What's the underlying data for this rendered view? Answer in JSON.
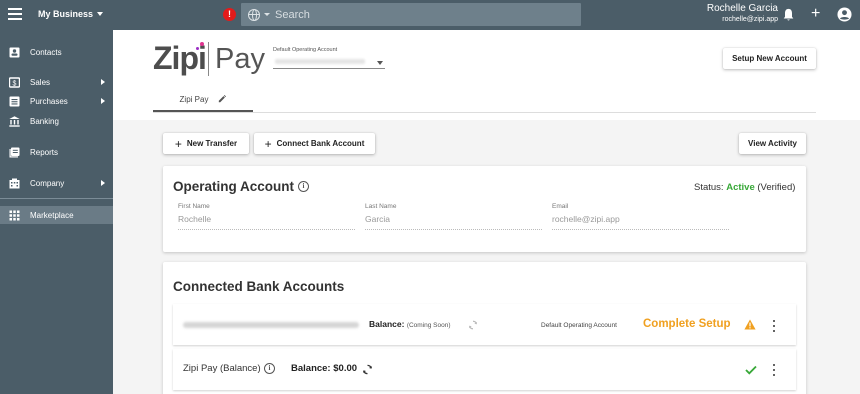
{
  "topbar": {
    "business_label": "My Business",
    "alert_badge": "!",
    "search_placeholder": "Search",
    "user_name": "Rochelle Garcia",
    "user_email": "rochelle@zipi.app",
    "plus_label": "+"
  },
  "sidebar": {
    "items": [
      {
        "label": "Contacts",
        "icon": "contacts-icon"
      },
      {
        "label": "Sales",
        "icon": "sales-icon",
        "has_submenu": true
      },
      {
        "label": "Purchases",
        "icon": "purchases-icon",
        "has_submenu": true
      },
      {
        "label": "Banking",
        "icon": "bank-icon"
      },
      {
        "label": "Reports",
        "icon": "reports-icon"
      },
      {
        "label": "Company",
        "icon": "company-icon",
        "has_submenu": true
      },
      {
        "label": "Marketplace",
        "icon": "grid-icon",
        "active": true
      }
    ]
  },
  "header": {
    "logo_text_left": "Zipi",
    "logo_text_right": "Pay",
    "default_operating_account_label": "Default Operating Account",
    "setup_new_account_label": "Setup New Account",
    "tab_label": "Zipi Pay"
  },
  "actions": {
    "new_transfer_label": "New Transfer",
    "connect_bank_label": "Connect Bank Account",
    "view_activity_label": "View Activity"
  },
  "operating_account": {
    "title": "Operating Account",
    "status_label": "Status:",
    "status_value": "Active",
    "status_suffix": "(Verified)",
    "fields": [
      {
        "label": "First Name",
        "value": "Rochelle"
      },
      {
        "label": "Last Name",
        "value": "Garcia"
      },
      {
        "label": "Email",
        "value": "rochelle@zipi.app"
      }
    ]
  },
  "connected_accounts": {
    "title": "Connected Bank Accounts",
    "rows": [
      {
        "balance_label": "Balance:",
        "balance_value": "(Coming Soon)",
        "tag": "Default Operating Account",
        "action": "Complete Setup"
      },
      {
        "name": "Zipi Pay (Balance)",
        "balance_label": "Balance:",
        "balance_value": "$0.00"
      }
    ]
  },
  "colors": {
    "nav_bg": "#4b5d68",
    "search_bg": "#6e808b",
    "status_active": "#38a838",
    "complete_setup": "#f0a020",
    "alert": "#e31b1b",
    "logo_dot_pink": "#e0338f",
    "logo_dot_purple": "#9c2fc4"
  }
}
